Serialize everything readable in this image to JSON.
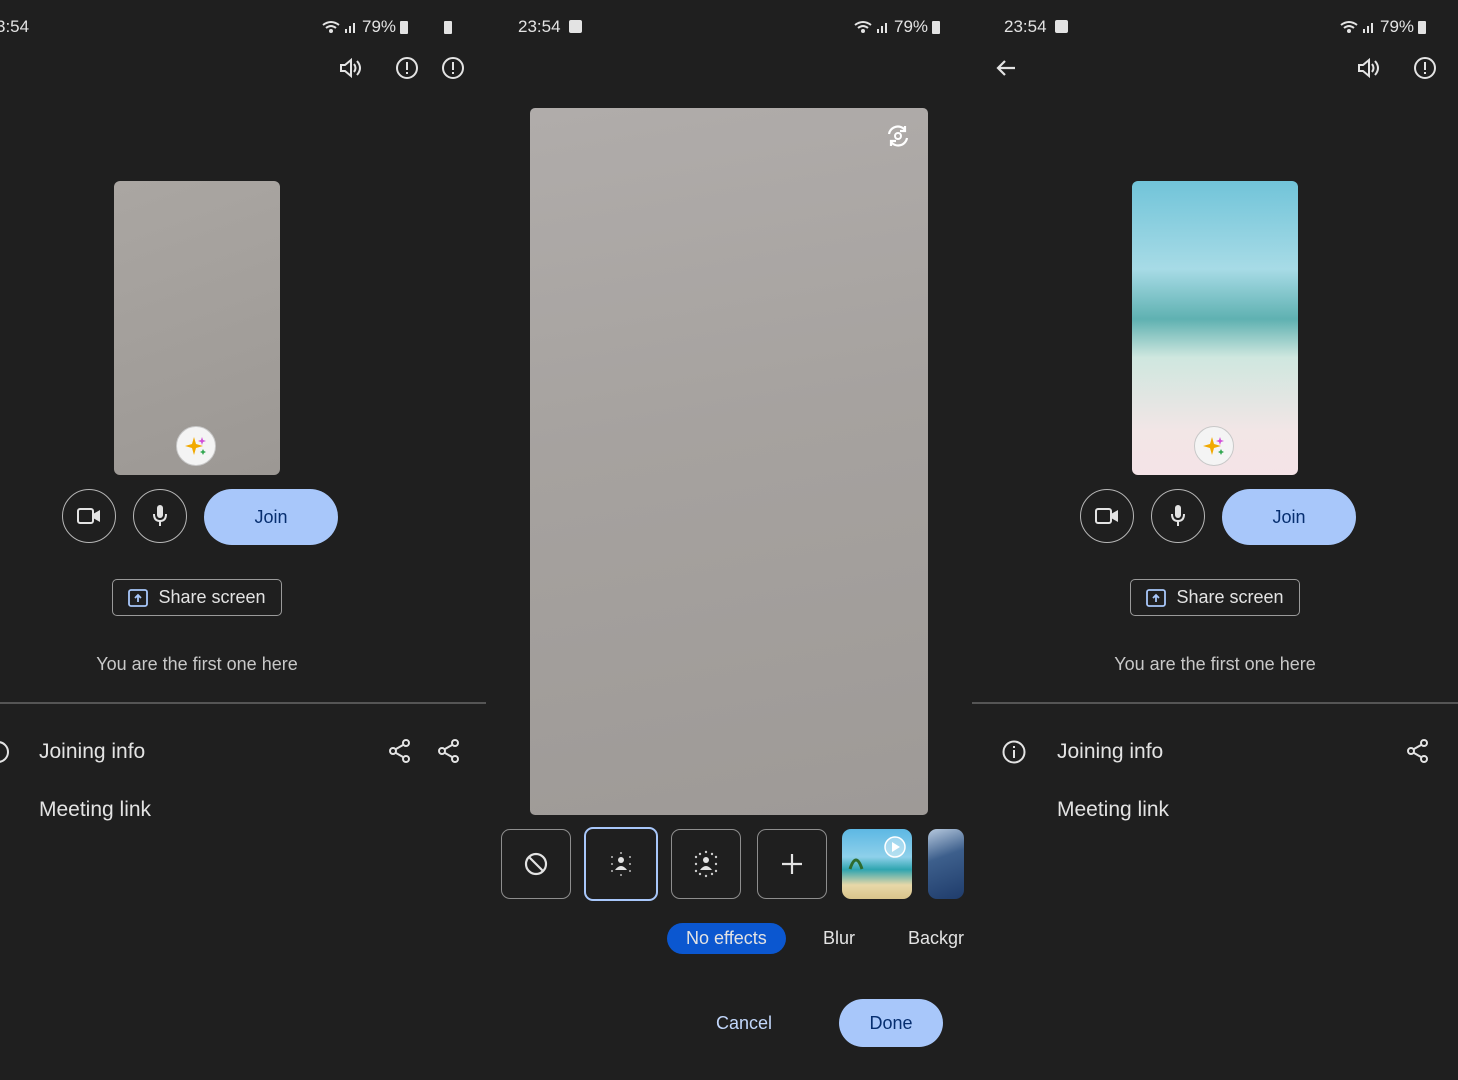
{
  "panels": [
    {
      "status_time": "3:54",
      "battery": "79%",
      "join_label": "Join",
      "share_label": "Share screen",
      "first_text": "You are the first one here",
      "joining_info": "Joining info",
      "meeting_link": "Meeting link",
      "preview_background": "gray"
    },
    {
      "status_time": "23:54",
      "battery": "79%",
      "effects": {
        "labels": [
          "No effects",
          "Blur",
          "Backgr"
        ],
        "selected_label": "No effects"
      },
      "cancel_label": "Cancel",
      "done_label": "Done"
    },
    {
      "status_time": "23:54",
      "battery": "79%",
      "join_label": "Join",
      "share_label": "Share screen",
      "first_text": "You are the first one here",
      "joining_info": "Joining info",
      "meeting_link": "Meeting link",
      "preview_background": "beach"
    }
  ],
  "colors": {
    "background": "#1f1f1f",
    "accent": "#a8c7fa",
    "chip_selected": "#0b57d0"
  }
}
